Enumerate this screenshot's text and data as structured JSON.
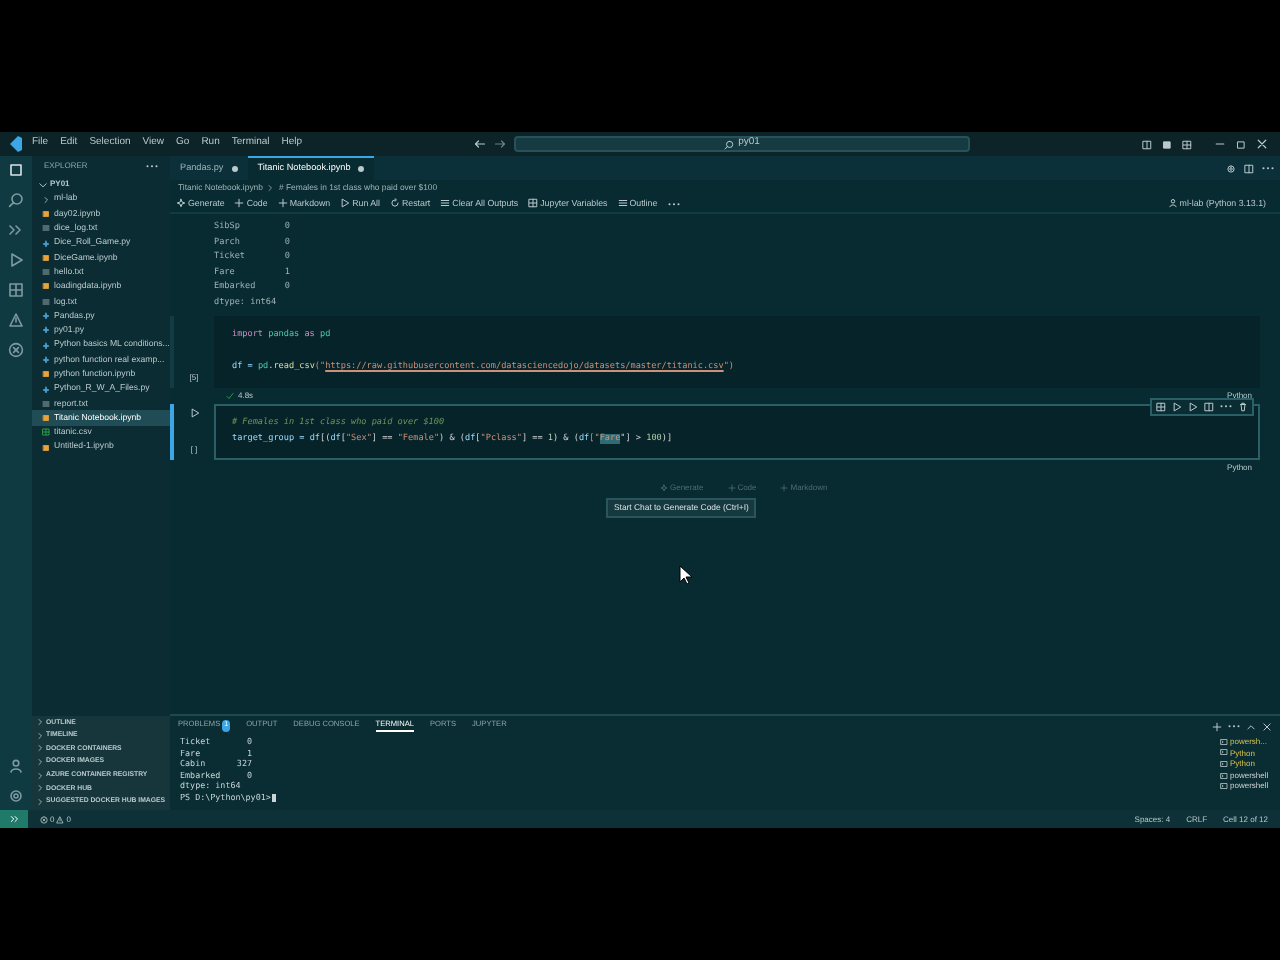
{
  "menu": [
    "File",
    "Edit",
    "Selection",
    "View",
    "Go",
    "Run",
    "Terminal",
    "Help"
  ],
  "search": {
    "value": "py01"
  },
  "explorer": {
    "title": "EXPLORER",
    "root": "PY01",
    "items": [
      {
        "label": "ml-lab",
        "kind": "folder",
        "selected": false
      },
      {
        "label": "day02.ipynb",
        "kind": "notebook",
        "selected": false
      },
      {
        "label": "dice_log.txt",
        "kind": "text",
        "selected": false
      },
      {
        "label": "Dice_Roll_Game.py",
        "kind": "python",
        "selected": false
      },
      {
        "label": "DiceGame.ipynb",
        "kind": "notebook",
        "selected": false
      },
      {
        "label": "hello.txt",
        "kind": "text",
        "selected": false
      },
      {
        "label": "loadingdata.ipynb",
        "kind": "notebook",
        "selected": false
      },
      {
        "label": "log.txt",
        "kind": "text",
        "selected": false
      },
      {
        "label": "Pandas.py",
        "kind": "python",
        "selected": false
      },
      {
        "label": "py01.py",
        "kind": "python",
        "selected": false
      },
      {
        "label": "Python basics ML conditions...",
        "kind": "python",
        "selected": false
      },
      {
        "label": "python function real examp...",
        "kind": "python",
        "selected": false
      },
      {
        "label": "python function.ipynb",
        "kind": "notebook",
        "selected": false
      },
      {
        "label": "Python_R_W_A_Files.py",
        "kind": "python",
        "selected": false
      },
      {
        "label": "report.txt",
        "kind": "text",
        "selected": false
      },
      {
        "label": "Titanic Notebook.ipynb",
        "kind": "notebook",
        "selected": true
      },
      {
        "label": "titanic.csv",
        "kind": "csv",
        "selected": false
      },
      {
        "label": "Untitled-1.ipynb",
        "kind": "notebook",
        "selected": false
      }
    ],
    "sections": [
      "OUTLINE",
      "TIMELINE",
      "DOCKER CONTAINERS",
      "DOCKER IMAGES",
      "AZURE CONTAINER REGISTRY",
      "DOCKER HUB",
      "SUGGESTED DOCKER HUB IMAGES"
    ]
  },
  "tabs": [
    {
      "label": "Pandas.py",
      "selected": false
    },
    {
      "label": "Titanic Notebook.ipynb",
      "selected": true
    }
  ],
  "breadcrumb": [
    "Titanic Notebook.ipynb",
    "# Females in 1st class who paid over $100"
  ],
  "toolbar": [
    "Generate",
    "Code",
    "Markdown",
    "Run All",
    "Restart",
    "Clear All Outputs",
    "Jupyter Variables",
    "Outline"
  ],
  "kernel": "ml-lab (Python 3.13.1)",
  "output_lines": [
    {
      "name": "SibSp",
      "value": "0"
    },
    {
      "name": "Parch",
      "value": "0"
    },
    {
      "name": "Ticket",
      "value": "0"
    },
    {
      "name": "Fare",
      "value": "1"
    },
    {
      "name": "Embarked",
      "value": "0"
    },
    {
      "name": "dtype: int64"
    }
  ],
  "cells": [
    {
      "lines": [
        [
          {
            "text": "import ",
            "kind": "kw"
          },
          {
            "text": "pandas ",
            "kind": "mod"
          },
          {
            "text": "as ",
            "kind": "kw"
          },
          {
            "text": "pd",
            "kind": "mod"
          }
        ],
        [
          {
            "text": "df = ",
            "kind": "var"
          },
          {
            "text": "pd",
            "kind": "mod"
          },
          {
            "text": ".",
            "kind": "plain"
          },
          {
            "text": "read_csv",
            "kind": "fn"
          },
          {
            "text": "(\"",
            "kind": "str"
          },
          {
            "text": "https://raw.githubusercontent.com/datasciencedojo/datasets/master/titanic.csv",
            "kind": "link"
          },
          {
            "text": "\")",
            "kind": "str"
          }
        ]
      ],
      "count": "[5]",
      "time": "4.8s",
      "language": "Python",
      "focused": false
    },
    {
      "lines": [
        [
          {
            "text": "# Females in 1st class who paid over $100",
            "kind": "comment"
          }
        ],
        [
          {
            "text": "target_group = ",
            "kind": "var"
          },
          {
            "text": "df",
            "kind": "var"
          },
          {
            "text": "[(",
            "kind": "plain"
          },
          {
            "text": "df",
            "kind": "var"
          },
          {
            "text": "[",
            "kind": "plain"
          },
          {
            "text": "\"Sex\"",
            "kind": "str"
          },
          {
            "text": "] == ",
            "kind": "plain"
          },
          {
            "text": "\"Female\"",
            "kind": "str"
          },
          {
            "text": ") & (",
            "kind": "plain"
          },
          {
            "text": "df",
            "kind": "var"
          },
          {
            "text": "[",
            "kind": "plain"
          },
          {
            "text": "\"Pclass\"",
            "kind": "str"
          },
          {
            "text": "] == ",
            "kind": "plain"
          },
          {
            "text": "1",
            "kind": "num"
          },
          {
            "text": ") & (",
            "kind": "plain"
          },
          {
            "text": "df",
            "kind": "var"
          },
          {
            "text": "[\"",
            "kind": "str"
          },
          {
            "text": "Fare",
            "kind": "hl"
          },
          {
            "text": "\"] > ",
            "kind": "plain"
          },
          {
            "text": "100",
            "kind": "num"
          },
          {
            "text": ")]",
            "kind": "plain"
          }
        ]
      ],
      "count": "[ ]",
      "language": "Python",
      "focused": true
    }
  ],
  "add_buttons": [
    "Generate",
    "Code",
    "Markdown"
  ],
  "tooltip": "Start Chat to Generate Code (Ctrl+I)",
  "panel": {
    "tabs": [
      {
        "label": "PROBLEMS",
        "badge": "1",
        "selected": false
      },
      {
        "label": "OUTPUT",
        "selected": false
      },
      {
        "label": "DEBUG CONSOLE",
        "selected": false
      },
      {
        "label": "TERMINAL",
        "selected": true
      },
      {
        "label": "PORTS",
        "selected": false
      },
      {
        "label": "JUPYTER",
        "selected": false
      }
    ],
    "terminal_lines": [
      {
        "name": "Ticket",
        "value": "0"
      },
      {
        "name": "Fare",
        "value": "1"
      },
      {
        "name": "Cabin",
        "value": "327"
      },
      {
        "name": "Embarked",
        "value": "0"
      },
      {
        "name": "dtype: int64"
      }
    ],
    "prompt": "PS D:\\Python\\py01>",
    "terminals": [
      {
        "label": "powersh...",
        "kind": "python"
      },
      {
        "label": "Python",
        "kind": "python"
      },
      {
        "label": "Python",
        "kind": "python"
      },
      {
        "label": "powershell",
        "kind": "shell"
      },
      {
        "label": "powershell",
        "kind": "shell"
      }
    ]
  },
  "status": {
    "errors": "0",
    "warnings": "0",
    "right": [
      "Spaces: 4",
      "CRLF",
      "Cell 12 of 12"
    ]
  }
}
